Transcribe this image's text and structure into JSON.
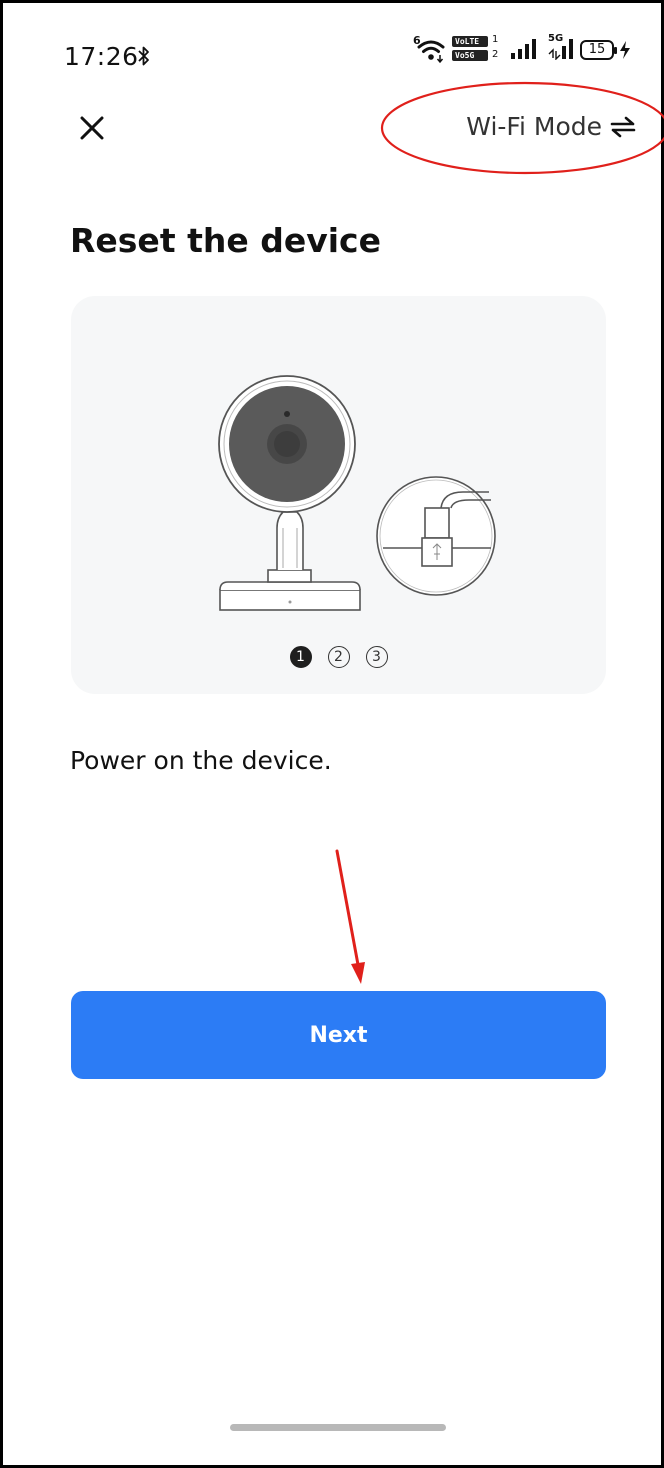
{
  "status_bar": {
    "time": "17:26",
    "wifi_generation": "6",
    "volte_badges": [
      "VoLTE",
      "Vo5G"
    ],
    "volte_sim_numbers": [
      "1",
      "2"
    ],
    "network_label": "5G",
    "battery_level": "15"
  },
  "top_bar": {
    "close_icon": "close-icon",
    "wifi_mode_label": "Wi-Fi Mode",
    "wifi_mode_icon": "swap-arrows-icon"
  },
  "page": {
    "title": "Reset the device",
    "instruction": "Power on the device."
  },
  "step_indicator": {
    "steps": [
      "1",
      "2",
      "3"
    ],
    "current_step": 1
  },
  "actions": {
    "next_label": "Next"
  },
  "colors": {
    "primary_button": "#2c7cf5",
    "annotation": "#e0201b",
    "card_background": "#f6f7f8"
  }
}
